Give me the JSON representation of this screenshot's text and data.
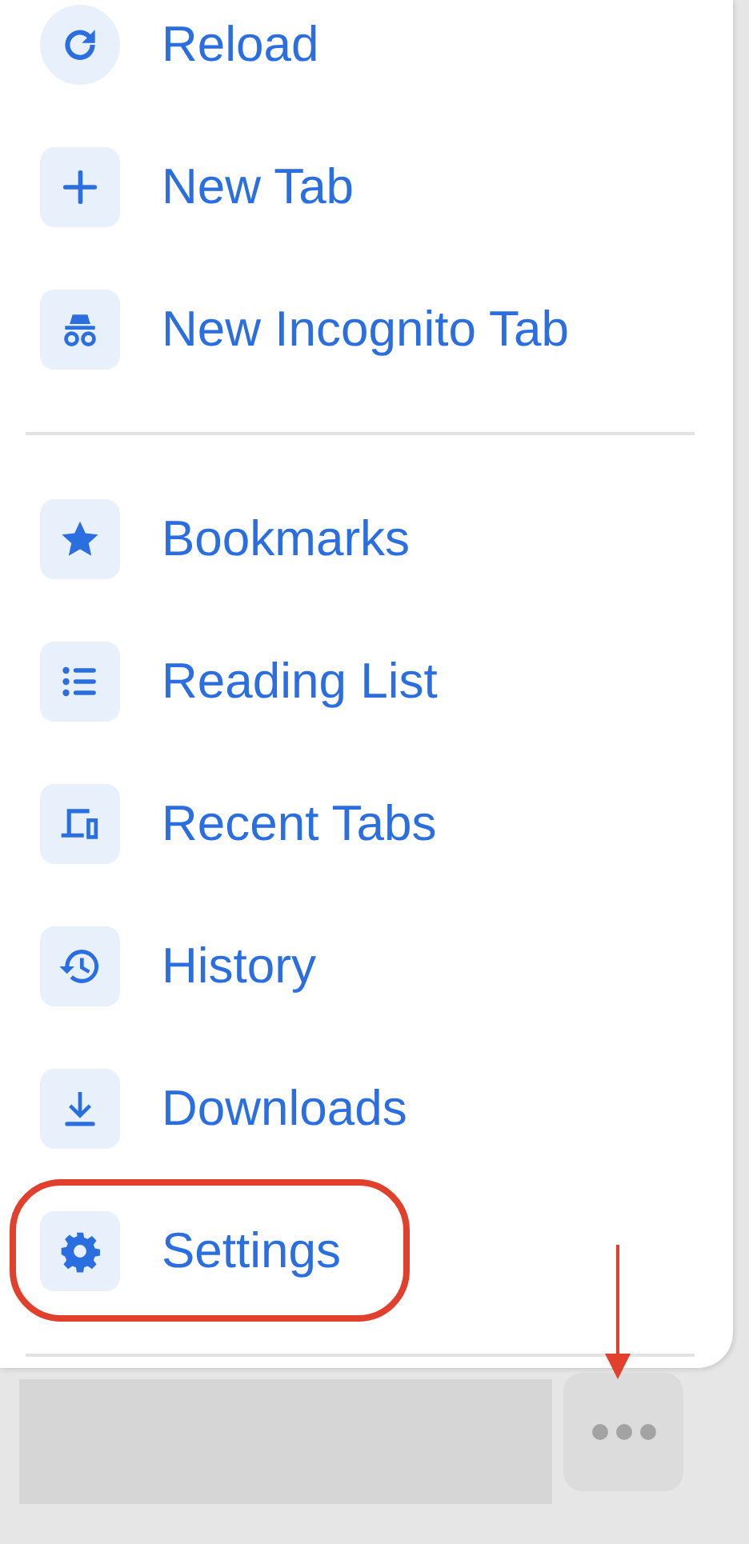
{
  "menu": {
    "sections": [
      {
        "items": [
          {
            "label": "Reload",
            "annotated": false
          },
          {
            "label": "New Tab",
            "annotated": false
          },
          {
            "label": "New Incognito Tab",
            "annotated": false
          }
        ]
      },
      {
        "items": [
          {
            "label": "Bookmarks",
            "annotated": false
          },
          {
            "label": "Reading List",
            "annotated": false
          },
          {
            "label": "Recent Tabs",
            "annotated": false
          },
          {
            "label": "History",
            "annotated": false
          },
          {
            "label": "Downloads",
            "annotated": false
          },
          {
            "label": "Settings",
            "annotated": true
          }
        ]
      }
    ]
  },
  "toolbar": {
    "more_button": {
      "annotated": true
    }
  }
}
